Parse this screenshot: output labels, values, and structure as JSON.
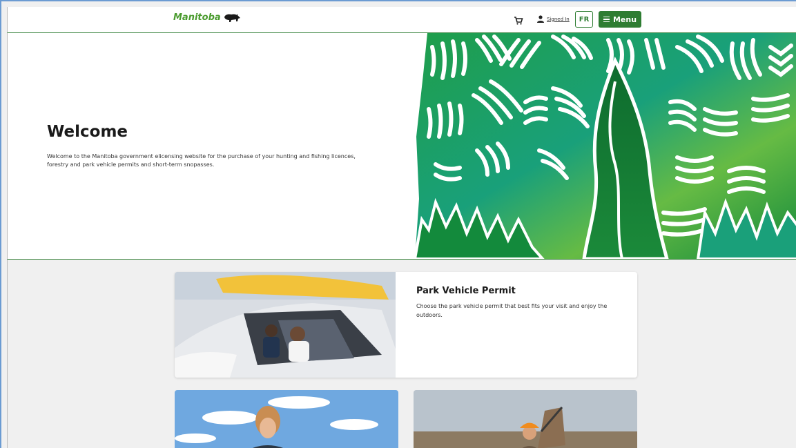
{
  "header": {
    "logo_text": "Manitoba",
    "cart_icon": "cart-icon",
    "signin_label": "Signed In",
    "lang_label": "FR",
    "menu_label": "Menu"
  },
  "hero": {
    "title": "Welcome",
    "text": "Welcome to the Manitoba government elicensing website for the purchase of your hunting and fishing licences, forestry and park vehicle permits and short-term snopasses."
  },
  "cards": {
    "park": {
      "title": "Park Vehicle Permit",
      "desc": "Choose the park vehicle permit that best fits your visit and enjoy the outdoors."
    }
  },
  "colors": {
    "brand_green": "#2e7d32",
    "logo_green": "#4a9b2e",
    "page_bg": "#f0f0f0"
  }
}
